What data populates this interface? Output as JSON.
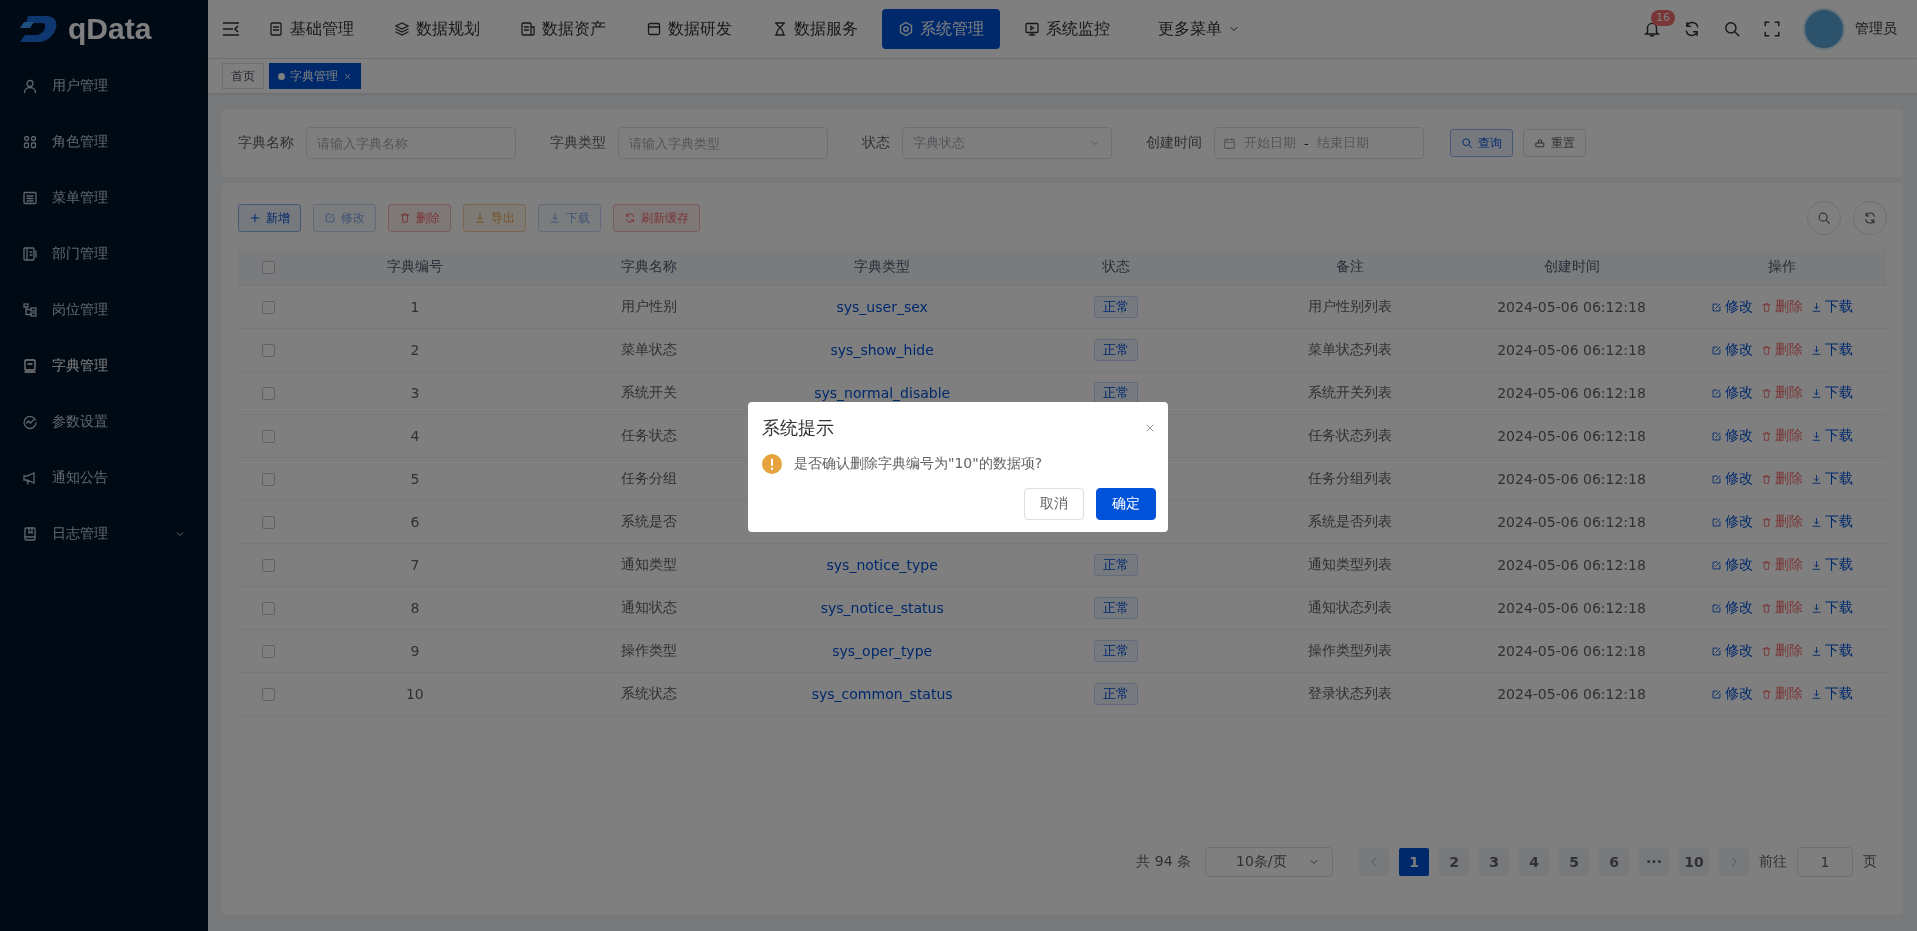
{
  "brand": {
    "name": "qData"
  },
  "sidebar": {
    "items": [
      {
        "label": "用户管理",
        "selected": false,
        "expandable": false
      },
      {
        "label": "角色管理",
        "selected": false,
        "expandable": false
      },
      {
        "label": "菜单管理",
        "selected": false,
        "expandable": false
      },
      {
        "label": "部门管理",
        "selected": false,
        "expandable": false
      },
      {
        "label": "岗位管理",
        "selected": false,
        "expandable": false
      },
      {
        "label": "字典管理",
        "selected": true,
        "expandable": false
      },
      {
        "label": "参数设置",
        "selected": false,
        "expandable": false
      },
      {
        "label": "通知公告",
        "selected": false,
        "expandable": false
      },
      {
        "label": "日志管理",
        "selected": false,
        "expandable": true
      }
    ]
  },
  "top_nav": {
    "items": [
      {
        "label": "基础管理",
        "selected": false
      },
      {
        "label": "数据规划",
        "selected": false
      },
      {
        "label": "数据资产",
        "selected": false
      },
      {
        "label": "数据研发",
        "selected": false
      },
      {
        "label": "数据服务",
        "selected": false
      },
      {
        "label": "系统管理",
        "selected": true
      },
      {
        "label": "系统监控",
        "selected": false
      }
    ],
    "more_menu": "更多菜单",
    "notification_count": "16",
    "user": "管理员"
  },
  "tags": [
    {
      "label": "首页",
      "selected": false,
      "closable": false
    },
    {
      "label": "字典管理",
      "selected": true,
      "closable": true
    }
  ],
  "search": {
    "fields": [
      {
        "label": "字典名称",
        "placeholder": "请输入字典名称",
        "kind": "input"
      },
      {
        "label": "字典类型",
        "placeholder": "请输入字典类型",
        "kind": "input"
      },
      {
        "label": "状态",
        "placeholder": "字典状态",
        "kind": "select"
      },
      {
        "label": "创建时间",
        "start_placeholder": "开始日期",
        "separator": "-",
        "end_placeholder": "结束日期",
        "kind": "daterange"
      }
    ],
    "buttons": [
      {
        "label": "查询",
        "kind": "primary"
      },
      {
        "label": "重置",
        "kind": "default"
      }
    ]
  },
  "toolbar": [
    {
      "label": "新增",
      "kind": "primary",
      "disabled": false
    },
    {
      "label": "修改",
      "kind": "primary",
      "disabled": true
    },
    {
      "label": "删除",
      "kind": "danger",
      "disabled": false
    },
    {
      "label": "导出",
      "kind": "warning",
      "disabled": false
    },
    {
      "label": "下载",
      "kind": "primary",
      "disabled": true
    },
    {
      "label": "刷新缓存",
      "kind": "danger",
      "disabled": false
    }
  ],
  "table": {
    "header_checked": false,
    "columns": [
      "字典编号",
      "字典名称",
      "字典类型",
      "状态",
      "备注",
      "创建时间",
      "操作"
    ],
    "rows": [
      {
        "checked": false,
        "id": "1",
        "name": "用户性别",
        "type": "sys_user_sex",
        "status": "正常",
        "remark": "用户性别列表",
        "created": "2024-05-06 06:12:18",
        "actions": [
          "修改",
          "删除",
          "下载"
        ]
      },
      {
        "checked": false,
        "id": "2",
        "name": "菜单状态",
        "type": "sys_show_hide",
        "status": "正常",
        "remark": "菜单状态列表",
        "created": "2024-05-06 06:12:18",
        "actions": [
          "修改",
          "删除",
          "下载"
        ]
      },
      {
        "checked": false,
        "id": "3",
        "name": "系统开关",
        "type": "sys_normal_disable",
        "status": "正常",
        "remark": "系统开关列表",
        "created": "2024-05-06 06:12:18",
        "actions": [
          "修改",
          "删除",
          "下载"
        ]
      },
      {
        "checked": false,
        "id": "4",
        "name": "任务状态",
        "remark": "任务状态列表",
        "created": "2024-05-06 06:12:18",
        "actions": [
          "修改",
          "删除",
          "下载"
        ]
      },
      {
        "checked": false,
        "id": "5",
        "name": "任务分组",
        "remark": "任务分组列表",
        "created": "2024-05-06 06:12:18",
        "actions": [
          "修改",
          "删除",
          "下载"
        ]
      },
      {
        "checked": false,
        "id": "6",
        "name": "系统是否",
        "remark": "系统是否列表",
        "created": "2024-05-06 06:12:18",
        "actions": [
          "修改",
          "删除",
          "下载"
        ]
      },
      {
        "checked": false,
        "id": "7",
        "name": "通知类型",
        "type": "sys_notice_type",
        "status": "正常",
        "remark": "通知类型列表",
        "created": "2024-05-06 06:12:18",
        "actions": [
          "修改",
          "删除",
          "下载"
        ]
      },
      {
        "checked": false,
        "id": "8",
        "name": "通知状态",
        "type": "sys_notice_status",
        "status": "正常",
        "remark": "通知状态列表",
        "created": "2024-05-06 06:12:18",
        "actions": [
          "修改",
          "删除",
          "下载"
        ]
      },
      {
        "checked": false,
        "id": "9",
        "name": "操作类型",
        "type": "sys_oper_type",
        "status": "正常",
        "remark": "操作类型列表",
        "created": "2024-05-06 06:12:18",
        "actions": [
          "修改",
          "删除",
          "下载"
        ]
      },
      {
        "checked": false,
        "id": "10",
        "name": "系统状态",
        "type": "sys_common_status",
        "status": "正常",
        "remark": "登录状态列表",
        "created": "2024-05-06 06:12:18",
        "actions": [
          "修改",
          "删除",
          "下载"
        ]
      }
    ]
  },
  "pagination": {
    "total": "共 94 条",
    "page_size": "10条/页",
    "pages": [
      {
        "label": "1",
        "selected": true
      },
      {
        "label": "2",
        "selected": false
      },
      {
        "label": "3",
        "selected": false
      },
      {
        "label": "4",
        "selected": false
      },
      {
        "label": "5",
        "selected": false
      },
      {
        "label": "6",
        "selected": false
      },
      {
        "label": "···",
        "selected": false
      },
      {
        "label": "10",
        "selected": false
      }
    ],
    "goto_label": "前往",
    "goto_value": "1",
    "page_unit": "页"
  },
  "dialog": {
    "title": "系统提示",
    "message": "是否确认删除字典编号为\"10\"的数据项?",
    "buttons": [
      {
        "label": "取消",
        "kind": "default"
      },
      {
        "label": "确定",
        "kind": "primary"
      }
    ]
  }
}
